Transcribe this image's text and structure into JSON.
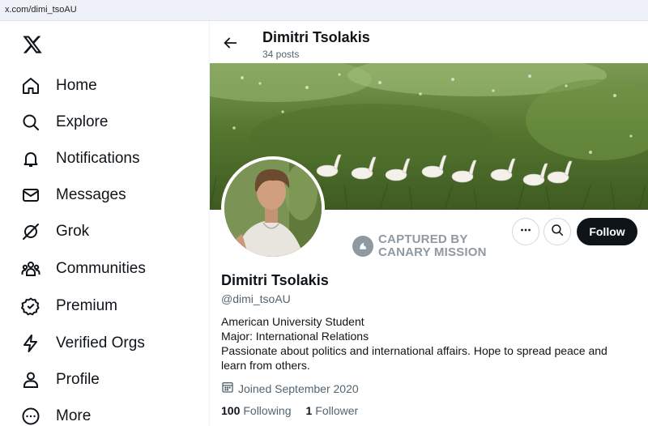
{
  "browser": {
    "url": "x.com/dimi_tsoAU"
  },
  "sidebar": {
    "logo": "x-logo",
    "items": [
      {
        "label": "Home",
        "icon": "home-icon"
      },
      {
        "label": "Explore",
        "icon": "search-icon"
      },
      {
        "label": "Notifications",
        "icon": "bell-icon"
      },
      {
        "label": "Messages",
        "icon": "envelope-icon"
      },
      {
        "label": "Grok",
        "icon": "grok-icon"
      },
      {
        "label": "Communities",
        "icon": "people-icon"
      },
      {
        "label": "Premium",
        "icon": "verified-badge-icon"
      },
      {
        "label": "Verified Orgs",
        "icon": "lightning-icon"
      },
      {
        "label": "Profile",
        "icon": "user-icon"
      },
      {
        "label": "More",
        "icon": "more-circle-icon"
      }
    ]
  },
  "header": {
    "name": "Dimitri Tsolakis",
    "posts": "34 posts"
  },
  "watermark": {
    "line1": "CAPTURED BY",
    "line2": "CANARY MISSION"
  },
  "actions": {
    "follow_label": "Follow"
  },
  "profile": {
    "name": "Dimitri Tsolakis",
    "handle": "@dimi_tsoAU",
    "bio": [
      "American University Student",
      "Major: International Relations",
      "Passionate about politics and international affairs. Hope to spread peace and learn from others."
    ],
    "joined": "Joined September 2020",
    "following_count": "100",
    "following_label": "Following",
    "followers_count": "1",
    "followers_label": "Follower"
  },
  "colors": {
    "text": "#0f1419",
    "secondary": "#536471",
    "border": "#cfd9de",
    "follow_bg": "#0f1419"
  }
}
